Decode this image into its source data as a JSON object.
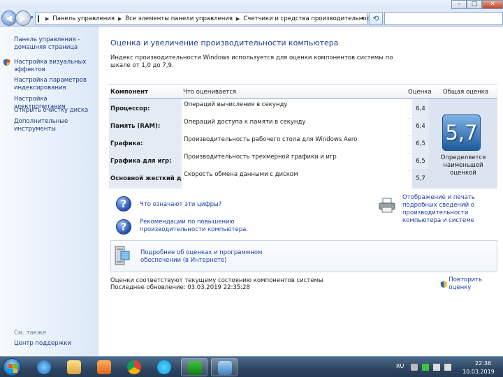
{
  "breadcrumbs": [
    "Панель управления",
    "Все элементы панели управления",
    "Счетчики и средства производительности"
  ],
  "left_pane": {
    "links": [
      {
        "label": "Панель управления -\nдомашняя страница"
      },
      {
        "label": "Настройка визуальных\nэффектов"
      },
      {
        "label": "Настройка параметров\nиндексирования"
      },
      {
        "label": "Настройка электропитания"
      },
      {
        "label": "Открыть очистку диска"
      },
      {
        "label": "Дополнительные\nинструменты"
      }
    ],
    "see_also": "См. также",
    "support": "Центр поддержки"
  },
  "main": {
    "title": "Оценка и увеличение производительности компьютера",
    "description": "Индекс производительности Windows используется для оценки компонентов системы по шкале от 1,0 до 7,9.",
    "table": {
      "headers": {
        "component": "Компонент",
        "what": "Что оценивается",
        "score": "Оценка",
        "total": "Общая оценка"
      },
      "rows": [
        {
          "component": "Процессор:",
          "what": "Операций вычисления в секунду",
          "score": "6,4"
        },
        {
          "component": "Память (RAM):",
          "what": "Операций доступа к памяти в секунду",
          "score": "6,4"
        },
        {
          "component": "Графика:",
          "what": "Производительность рабочего стола для Windows Aero",
          "score": "6,5"
        },
        {
          "component": "Графика для игр:",
          "what": "Производительность трехмерной графики и игр",
          "score": "6,5"
        },
        {
          "component": "Основной жесткий диск:",
          "what": "Скорость обмена данными с диском",
          "score": "5,7"
        }
      ],
      "total_score": "5,7",
      "total_note": "Определяется наименьшей оценкой"
    },
    "links": {
      "what_mean": "Что означают эти цифры?",
      "recommendations": "Рекомендации по повышению производительности компьютера.",
      "print": "Отображение и печать подробных сведений о производительности компьютера и системе",
      "online": "Подробнее об оценках и программном обеспечении (в Интернете)"
    },
    "status_current": "Оценки соответствуют текущему состоянию компонентов системы",
    "status_updated": "Последнее обновление: 03.03.2019 22:35:28",
    "rerun": "Повторить оценку"
  },
  "taskbar": {
    "lang": "RU",
    "time": "22:36",
    "date": "10.03.2019"
  },
  "colors": {
    "link": "#1b3ea8",
    "title": "#1c3d89"
  }
}
